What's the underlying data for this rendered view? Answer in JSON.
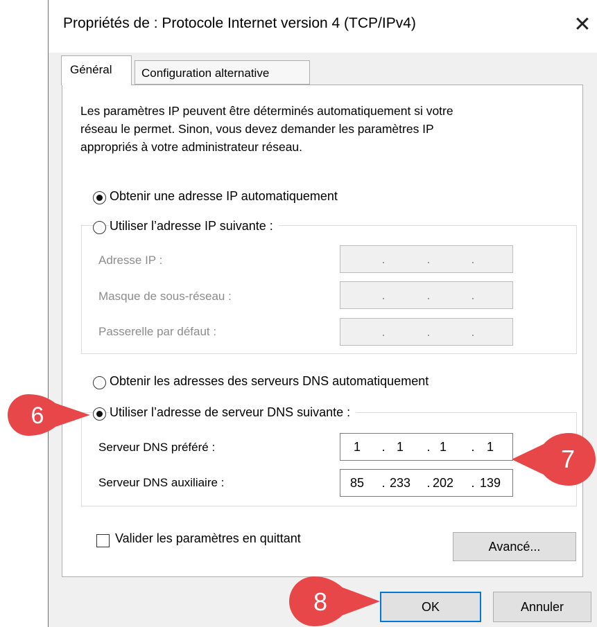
{
  "window": {
    "title": "Propriétés de : Protocole Internet version 4 (TCP/IPv4)",
    "close_icon": "close-icon"
  },
  "tabs": [
    {
      "label": "Général",
      "active": true
    },
    {
      "label": "Configuration alternative",
      "active": false
    }
  ],
  "description": [
    "Les paramètres IP peuvent être déterminés automatiquement si votre",
    "réseau le permet. Sinon, vous devez demander les paramètres IP",
    "appropriés à votre administrateur réseau."
  ],
  "ip": {
    "auto_label": "Obtenir une adresse IP automatiquement",
    "auto_selected": true,
    "manual_label": "Utiliser l’adresse IP suivante :",
    "manual_selected": false,
    "fields": [
      {
        "label": "Adresse IP :",
        "value": [
          "",
          "",
          "",
          ""
        ]
      },
      {
        "label": "Masque de sous-réseau :",
        "value": [
          "",
          "",
          "",
          ""
        ]
      },
      {
        "label": "Passerelle par défaut :",
        "value": [
          "",
          "",
          "",
          ""
        ]
      }
    ]
  },
  "dns": {
    "auto_label": "Obtenir les adresses des serveurs DNS automatiquement",
    "auto_selected": false,
    "manual_label": "Utiliser l’adresse de serveur DNS suivante :",
    "manual_selected": true,
    "preferred": {
      "label": "Serveur DNS préféré :",
      "value": [
        "1",
        "1",
        "1",
        "1"
      ]
    },
    "alternate": {
      "label": "Serveur DNS auxiliaire :",
      "value": [
        "85",
        "233",
        "202",
        "139"
      ]
    }
  },
  "validate": {
    "label": "Valider les paramètres en quittant",
    "checked": false
  },
  "buttons": {
    "advanced": "Avancé...",
    "ok": "OK",
    "cancel": "Annuler"
  },
  "callouts": [
    {
      "number": "6",
      "color": "#e8474a"
    },
    {
      "number": "7",
      "color": "#e8474a"
    },
    {
      "number": "8",
      "color": "#e8474a"
    }
  ],
  "colors": {
    "accent": "#0078d7",
    "callout": "#e8474a"
  }
}
